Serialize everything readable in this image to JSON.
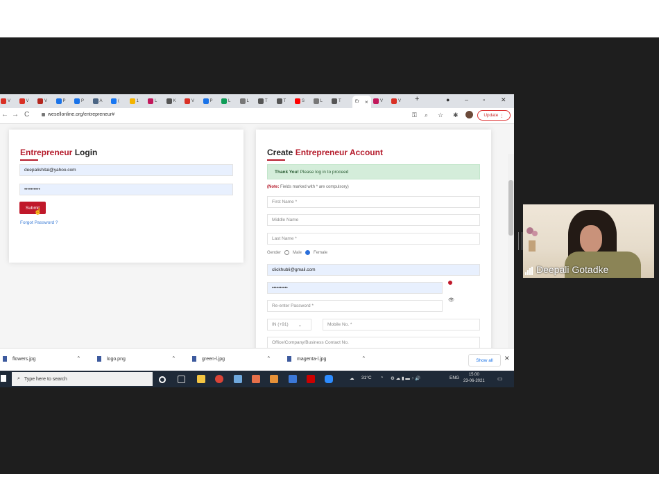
{
  "browser": {
    "url": "wesellonline.org/entrepreneur#",
    "update_label": "Update",
    "tabs": [
      {
        "letter": "V",
        "color": "#d93025"
      },
      {
        "letter": "V",
        "color": "#d93025"
      },
      {
        "letter": "V",
        "color": "#b3261e"
      },
      {
        "letter": "P",
        "color": "#1a73e8"
      },
      {
        "letter": "P",
        "color": "#1a73e8"
      },
      {
        "letter": "A",
        "color": "#4b6584"
      },
      {
        "letter": "(",
        "color": "#1877f2"
      },
      {
        "letter": "1",
        "color": "#f4b400"
      },
      {
        "letter": "L",
        "color": "#c2185b"
      },
      {
        "letter": "K",
        "color": "#555555"
      },
      {
        "letter": "V",
        "color": "#d93025"
      },
      {
        "letter": "P",
        "color": "#1a73e8"
      },
      {
        "letter": "L",
        "color": "#0f9d58"
      },
      {
        "letter": "L",
        "color": "#777777"
      },
      {
        "letter": "T",
        "color": "#555555"
      },
      {
        "letter": "T",
        "color": "#555555"
      },
      {
        "letter": "S",
        "color": "#ff0000"
      },
      {
        "letter": "L",
        "color": "#777777"
      },
      {
        "letter": "T",
        "color": "#555555"
      }
    ],
    "active_tab": "Er",
    "tabs_after": [
      {
        "letter": "V",
        "color": "#c2185b"
      },
      {
        "letter": "V",
        "color": "#d93025"
      }
    ]
  },
  "login": {
    "title_red": "Entrepreneur",
    "title_rest": "Login",
    "email": "deepalishital@yahoo.com",
    "password": "••••••••••",
    "submit": "Submit",
    "forgot": "Forgot Password ?"
  },
  "signup": {
    "title_plain": "Create",
    "title_red": "Entrepreneur Account",
    "alert_bold": "Thank You!",
    "alert_rest": "Please log in to proceed",
    "note_bold": "(Note:",
    "note_rest": "Fields marked with * are compulsory)",
    "first_name": "First Name *",
    "middle_name": "Middle Name",
    "last_name": "Last Name *",
    "gender_label": "Gender",
    "male": "Male",
    "female": "Female",
    "email": "clickhubli@gmail.com",
    "password": "••••••••••",
    "reenter": "Re-enter Password *",
    "country_code": "IN (+91)",
    "mobile": "Mobile No. *",
    "office": "Office/Company/Business Contact No."
  },
  "downloads": {
    "items": [
      "flowers.jpg",
      "logo.png",
      "green-l.jpg",
      "magenta-l.jpg"
    ],
    "show_all": "Show all"
  },
  "taskbar": {
    "search_placeholder": "Type here to search",
    "temp": "31°C",
    "lang": "ENG",
    "time": "15:00",
    "date": "23-06-2021"
  },
  "participant": {
    "name": "Deepali Gotadke"
  }
}
